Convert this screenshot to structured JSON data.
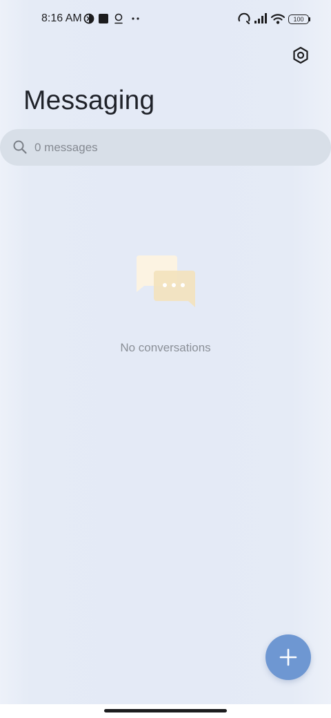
{
  "status_bar": {
    "time": "8:16 AM",
    "battery_level": "100",
    "icons": [
      "media-indicator-icon",
      "stop-square-icon",
      "location-pin-icon",
      "more-dots-icon",
      "hotspot-icon",
      "signal-icon",
      "wifi-icon",
      "battery-icon"
    ]
  },
  "header": {
    "title": "Messaging",
    "settings_icon": "settings-hexagon-icon"
  },
  "search": {
    "placeholder": "0 messages"
  },
  "empty_state": {
    "message": "No conversations",
    "illustration": "chat-bubbles-icon"
  },
  "fab": {
    "icon": "plus-icon",
    "color": "#6e97d2"
  },
  "colors": {
    "background": "#e4eaf6",
    "search_bg": "#d8dfe8",
    "accent": "#6e97d2",
    "title_text": "#1f2229"
  }
}
